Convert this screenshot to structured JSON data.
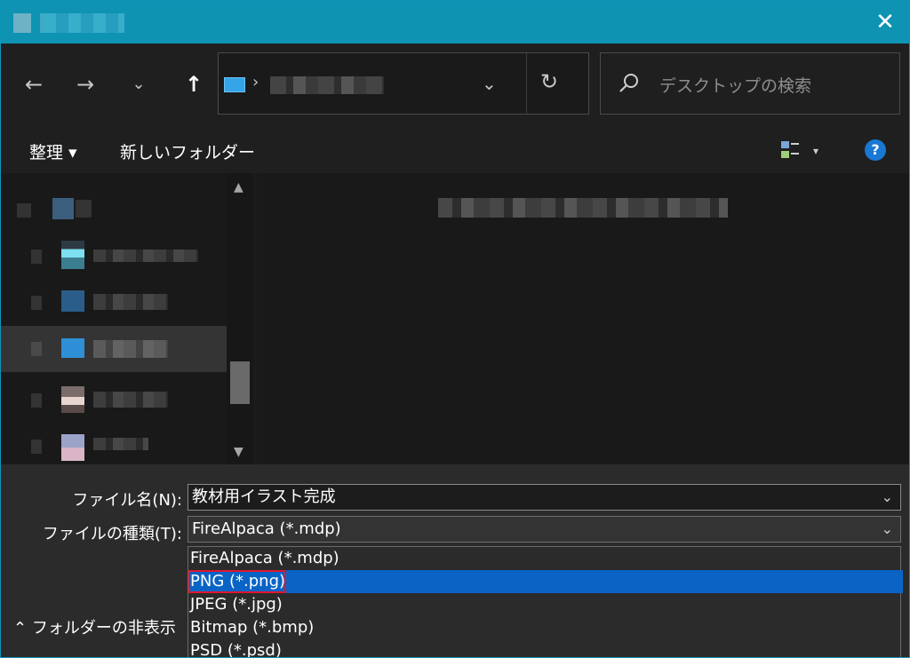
{
  "window": {
    "close_icon": "close-icon"
  },
  "nav": {
    "back_icon": "arrow-left-icon",
    "forward_icon": "arrow-right-icon",
    "recent_icon": "chevron-down-icon",
    "up_icon": "arrow-up-icon",
    "refresh_icon": "refresh-icon"
  },
  "search": {
    "placeholder": "デスクトップの検索"
  },
  "toolbar": {
    "organize_label": "整理 ▾",
    "new_folder_label": "新しいフォルダー",
    "help_label": "?"
  },
  "form": {
    "filename_label": "ファイル名(N):",
    "filename_value": "教材用イラスト完成",
    "filetype_label": "ファイルの種類(T):",
    "filetype_value": "FireAlpaca (*.mdp)"
  },
  "filetype_options": [
    {
      "label": "FireAlpaca (*.mdp)",
      "selected": false
    },
    {
      "label": "PNG (*.png)",
      "selected": true
    },
    {
      "label": "JPEG (*.jpg)",
      "selected": false
    },
    {
      "label": "Bitmap (*.bmp)",
      "selected": false
    },
    {
      "label": "PSD (*.psd)",
      "selected": false
    }
  ],
  "folder_toggle": {
    "label": "フォルダーの非表示"
  },
  "colors": {
    "accent": "#0e93b3",
    "selection": "#0a64c6",
    "highlight_box": "#e0172d"
  }
}
